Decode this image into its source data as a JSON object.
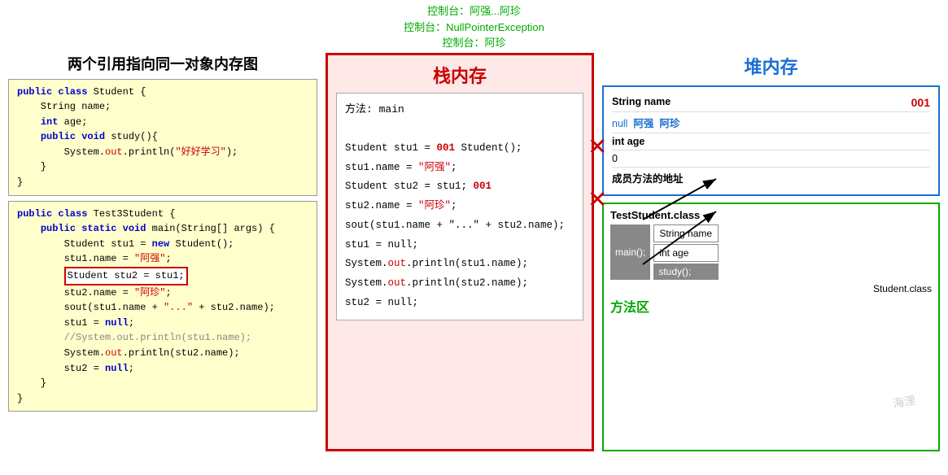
{
  "console": {
    "lines": [
      "控制台：阿强...阿珍",
      "控制台：NullPointerException",
      "控制台：阿珍"
    ]
  },
  "left": {
    "title": "两个引用指向同一对象内存图",
    "class1_code": [
      "public class Student {",
      "    String name;",
      "    int age;",
      "    public void study(){",
      "        System.out.println(\"好好学习\");",
      "    }",
      "}"
    ],
    "class2_code": [
      "public class Test3Student {",
      "    public static void main(String[] args) {",
      "        Student stu1 = new Student();",
      "        stu1.name = \"阿强\";",
      "        Student stu2 = stu1;",
      "        stu2.name = \"阿珍\";",
      "        sout(stu1.name + \"...\" + stu2.name);",
      "        stu1 = null;",
      "        //System.out.println(stu1.name);",
      "        System.out.println(stu2.name);",
      "        stu2 = null;",
      "    }",
      "}"
    ]
  },
  "stack": {
    "title": "栈内存",
    "method_label": "方法: main",
    "lines": [
      "Student stu1 = new Student();",
      "stu1.name = \"阿强\";",
      "Student stu2 = stu1;",
      "stu2.name = \"阿珍\";",
      "sout(stu1.name + \"...\" + stu2.name);",
      "stu1 = null;",
      "System.out.println(stu1.name);",
      "System.out.println(stu2.name);",
      "stu2 = null;"
    ],
    "addr_stu1": "001",
    "addr_stu2": "001"
  },
  "heap": {
    "title": "堆内存",
    "addr": "001",
    "fields": [
      {
        "name": "String name",
        "values": [
          "null",
          "阿强",
          "阿珍"
        ]
      },
      {
        "name": "int age",
        "values": [
          "0"
        ]
      },
      {
        "name": "成员方法的地址",
        "values": []
      }
    ]
  },
  "method_area": {
    "class_name": "TestStudent.class",
    "methods_left": [
      "main();"
    ],
    "fields_right": [
      "String name",
      "int age"
    ],
    "methods_right": [
      "study();"
    ],
    "student_class": "Student.class",
    "label": "方法区"
  }
}
